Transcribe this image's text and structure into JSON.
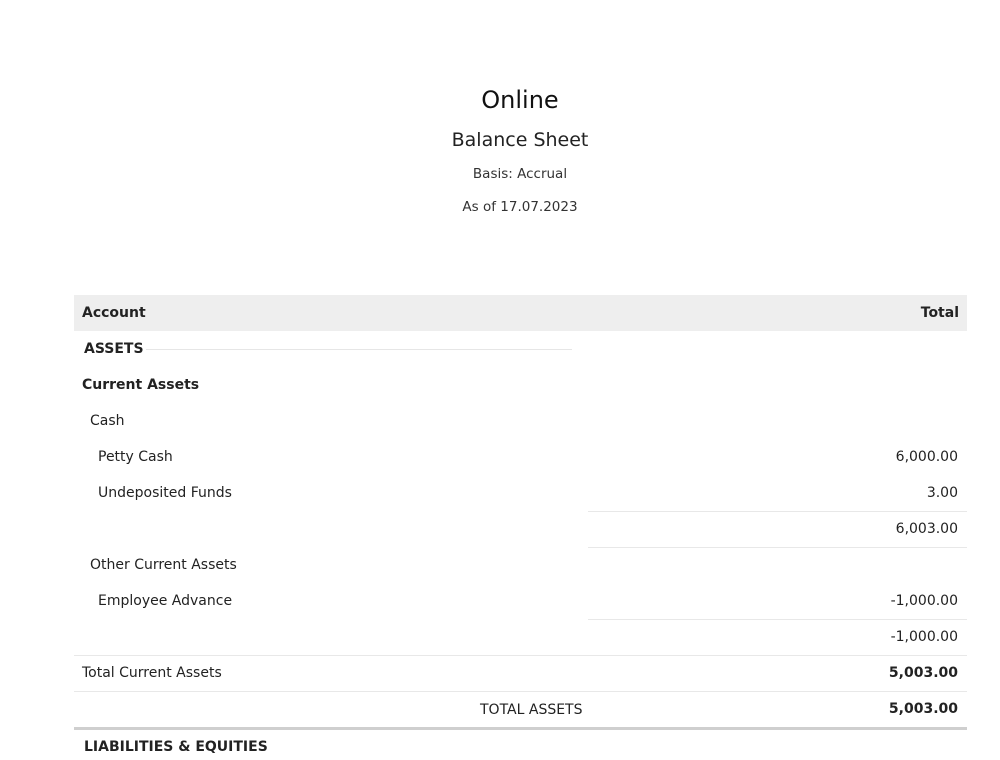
{
  "report": {
    "org_name": "Online",
    "title": "Balance Sheet",
    "basis": "Basis: Accrual",
    "as_of": "As of 17.07.2023"
  },
  "table": {
    "headers": {
      "account": "Account",
      "total": "Total"
    },
    "sections": {
      "assets": "ASSETS",
      "current_assets": "Current Assets",
      "cash": {
        "label": "Cash",
        "items": [
          {
            "name": "Petty Cash",
            "amount": "6,000.00"
          },
          {
            "name": "Undeposited Funds",
            "amount": "3.00"
          }
        ],
        "subtotal": "6,003.00"
      },
      "other_current_assets": {
        "label": "Other Current Assets",
        "items": [
          {
            "name": "Employee Advance",
            "amount": "-1,000.00"
          }
        ],
        "subtotal": "-1,000.00"
      },
      "total_current_assets": {
        "label": "Total Current Assets",
        "amount": "5,003.00"
      },
      "total_assets": {
        "label": "TOTAL ASSETS",
        "amount": "5,003.00"
      },
      "next": "LIABILITIES & EQUITIES"
    }
  }
}
